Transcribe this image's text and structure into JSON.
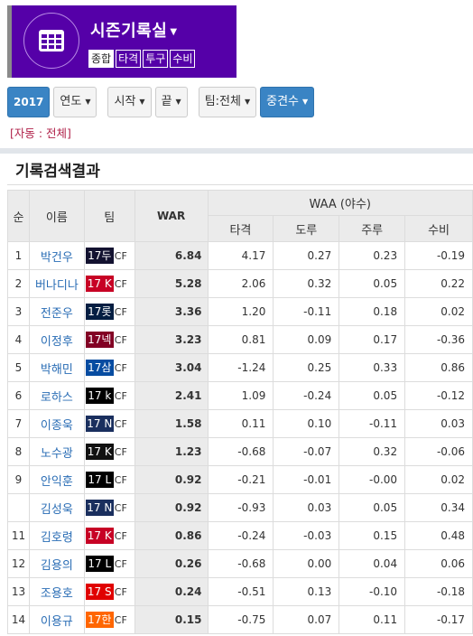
{
  "header": {
    "title": "시즌기록실",
    "tabs": [
      {
        "label": "종합",
        "active": true
      },
      {
        "label": "타격",
        "active": false
      },
      {
        "label": "투구",
        "active": false
      },
      {
        "label": "수비",
        "active": false
      }
    ],
    "icon": "table-grid-icon",
    "bg_color": "#5500a8"
  },
  "filters": {
    "year": "2017",
    "year_label": "연도",
    "start_label": "시작",
    "end_label": "끝",
    "team_label": "팀:전체",
    "sort_label": "중견수"
  },
  "auto_note": "[자동 : 전체]",
  "section_title": "기록검색결과",
  "table": {
    "headers": {
      "rank": "순",
      "name": "이름",
      "team": "팀",
      "war": "WAR",
      "waa": "WAA (야수)",
      "bat": "타격",
      "run": "도루",
      "base": "주루",
      "field": "수비"
    },
    "rows": [
      {
        "rank": "1",
        "name": "박건우",
        "team": "17두",
        "team_color": "#131230",
        "pos": "CF",
        "war": "6.84",
        "bat": "4.17",
        "run": "0.27",
        "base": "0.23",
        "field": "-0.19"
      },
      {
        "rank": "2",
        "name": "버나디나",
        "team": "17 K",
        "team_color": "#c70125",
        "pos": "CF",
        "war": "5.28",
        "bat": "2.06",
        "run": "0.32",
        "base": "0.05",
        "field": "0.22"
      },
      {
        "rank": "3",
        "name": "전준우",
        "team": "17롯",
        "team_color": "#041e42",
        "pos": "CF",
        "war": "3.36",
        "bat": "1.20",
        "run": "-0.11",
        "base": "0.18",
        "field": "0.02"
      },
      {
        "rank": "4",
        "name": "이정후",
        "team": "17넥",
        "team_color": "#820024",
        "pos": "CF",
        "war": "3.23",
        "bat": "0.81",
        "run": "0.09",
        "base": "0.17",
        "field": "-0.36"
      },
      {
        "rank": "5",
        "name": "박해민",
        "team": "17삼",
        "team_color": "#074ca1",
        "pos": "CF",
        "war": "3.04",
        "bat": "-1.24",
        "run": "0.25",
        "base": "0.33",
        "field": "0.86"
      },
      {
        "rank": "6",
        "name": "로하스",
        "team": "17 k",
        "team_color": "#000000",
        "pos": "CF",
        "war": "2.41",
        "bat": "1.09",
        "run": "-0.24",
        "base": "0.05",
        "field": "-0.12"
      },
      {
        "rank": "7",
        "name": "이종욱",
        "team": "17 N",
        "team_color": "#1a2f5e",
        "pos": "CF",
        "war": "1.58",
        "bat": "0.11",
        "run": "0.10",
        "base": "-0.11",
        "field": "0.03"
      },
      {
        "rank": "8",
        "name": "노수광",
        "team": "17 K",
        "team_color": "#111111",
        "pos": "CF",
        "war": "1.23",
        "bat": "-0.68",
        "run": "-0.07",
        "base": "0.32",
        "field": "-0.06"
      },
      {
        "rank": "9",
        "name": "안익훈",
        "team": "17 L",
        "team_color": "#000000",
        "pos": "CF",
        "war": "0.92",
        "bat": "-0.21",
        "run": "-0.01",
        "base": "-0.00",
        "field": "0.02"
      },
      {
        "rank": "",
        "name": "김성욱",
        "team": "17 N",
        "team_color": "#1a2f5e",
        "pos": "CF",
        "war": "0.92",
        "bat": "-0.93",
        "run": "0.03",
        "base": "0.05",
        "field": "0.34"
      },
      {
        "rank": "11",
        "name": "김호령",
        "team": "17 K",
        "team_color": "#c70125",
        "pos": "CF",
        "war": "0.86",
        "bat": "-0.24",
        "run": "-0.03",
        "base": "0.15",
        "field": "0.48"
      },
      {
        "rank": "12",
        "name": "김용의",
        "team": "17 L",
        "team_color": "#000000",
        "pos": "CF",
        "war": "0.26",
        "bat": "-0.68",
        "run": "0.00",
        "base": "0.04",
        "field": "0.06"
      },
      {
        "rank": "13",
        "name": "조용호",
        "team": "17 S",
        "team_color": "#e00000",
        "pos": "CF",
        "war": "0.24",
        "bat": "-0.51",
        "run": "0.13",
        "base": "-0.10",
        "field": "-0.18"
      },
      {
        "rank": "14",
        "name": "이용규",
        "team": "17한",
        "team_color": "#ff6600",
        "pos": "CF",
        "war": "0.15",
        "bat": "-0.75",
        "run": "0.07",
        "base": "0.11",
        "field": "-0.17"
      }
    ]
  }
}
